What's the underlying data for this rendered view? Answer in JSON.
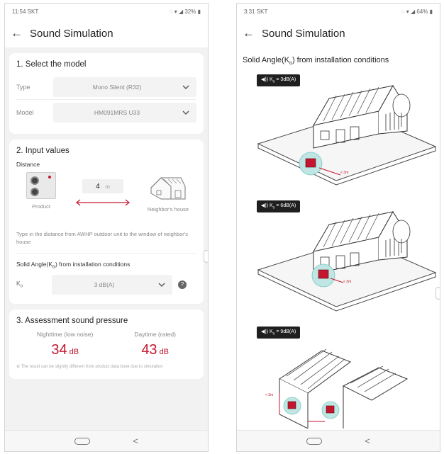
{
  "left": {
    "status": {
      "time": "11:54 SKT",
      "right": "signal 32%"
    },
    "appbar": {
      "title": "Sound Simulation"
    },
    "select_model": {
      "heading": "1. Select the model",
      "type_label": "Type",
      "type_value": "Mono Silent (R32)",
      "model_label": "Model",
      "model_value": "HM091MRS U33"
    },
    "input_values": {
      "heading": "2. Input values",
      "distance_label": "Distance",
      "distance_value": "4",
      "distance_unit": "m",
      "product_caption": "Product",
      "neighbor_caption": "Neighbor's house",
      "hint": "Type in the distance from AWHP outdoor unit to the window of neighbor's house",
      "solid_angle_label": "Solid Angle(K",
      "solid_angle_sub": "o",
      "solid_angle_suffix": ") from installation conditions",
      "ko_label": "K",
      "ko_sub": "o",
      "ko_value": "3 dB(A)",
      "help": "?"
    },
    "assessment": {
      "heading": "3. Assessment sound pressure",
      "night_caption": "Nighttime (low noise)",
      "night_value": "34",
      "night_unit": "dB",
      "day_caption": "Daytime (rated)",
      "day_value": "43",
      "day_unit": "dB",
      "note": "※ The result can be slightly different from product data book due to simulation"
    }
  },
  "right": {
    "status": {
      "time": "3:31 SKT",
      "right": "signal 64%"
    },
    "appbar": {
      "title": "Sound Simulation"
    },
    "title_prefix": "Solid Angle(K",
    "title_sub": "o",
    "title_suffix": ") from installation conditions",
    "cases": [
      {
        "tag_prefix": "◀)) K",
        "tag_sub": "o",
        "tag_value": " = 3dB(A)",
        "dist": "< 3m"
      },
      {
        "tag_prefix": "◀)) K",
        "tag_sub": "o",
        "tag_value": " = 6dB(A)",
        "dist": "< 3m"
      },
      {
        "tag_prefix": "◀)) K",
        "tag_sub": "o",
        "tag_value": " = 9dB(A)",
        "dist": "< 3m"
      }
    ]
  },
  "colors": {
    "accent": "#c4162f",
    "unit_red": "#c4162f",
    "teal_circle": "#bfe6e3"
  },
  "icons": [
    "back-arrow-icon",
    "chevron-down-icon",
    "outdoor-unit-icon",
    "house-icon",
    "help-icon",
    "speaker-icon",
    "home-pill-icon",
    "back-triangle-icon"
  ]
}
